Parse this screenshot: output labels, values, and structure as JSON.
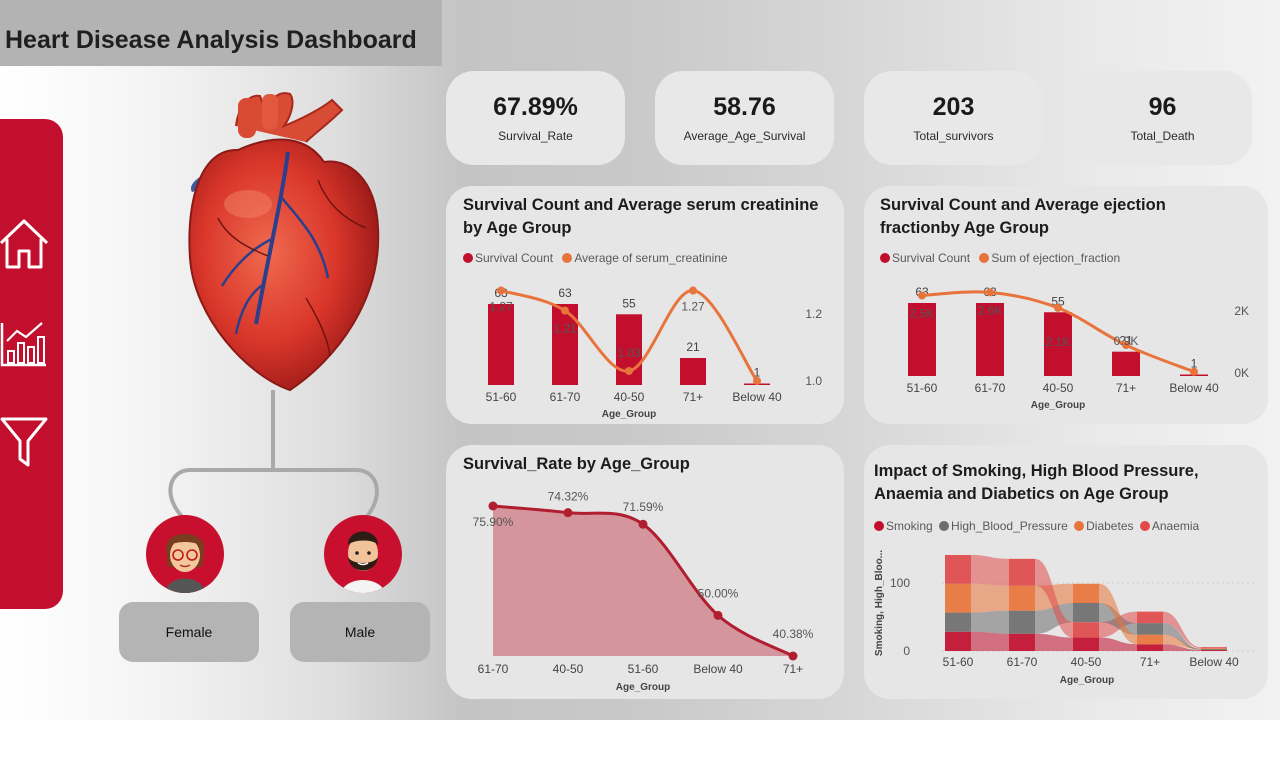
{
  "header": {
    "title": "Heart Disease Analysis Dashboard"
  },
  "nav": {
    "items": [
      "home-icon",
      "analytics-chart-icon",
      "filter-icon"
    ]
  },
  "colors": {
    "accent": "#c10f2d",
    "orange": "#e8743b",
    "grey": "#6e6e6e",
    "coral": "#e04a4a"
  },
  "gender": {
    "female_label": "Female",
    "male_label": "Male"
  },
  "kpis": [
    {
      "value": "67.89%",
      "label": "Survival_Rate"
    },
    {
      "value": "58.76",
      "label": "Average_Age_Survival"
    },
    {
      "value": "203",
      "label": "Total_survivors"
    },
    {
      "value": "96",
      "label": "Total_Death"
    }
  ],
  "chart_data": [
    {
      "type": "bar",
      "title": "Survival Count and Average serum creatinine by Age Group",
      "xlabel": "Age_Group",
      "categories": [
        "51-60",
        "61-70",
        "40-50",
        "71+",
        "Below 40"
      ],
      "series": [
        {
          "name": "Survival Count",
          "type": "bar",
          "values": [
            63,
            63,
            55,
            21,
            1
          ],
          "labels": [
            "63",
            "63",
            "55",
            "21",
            "1"
          ]
        },
        {
          "name": "Average of serum_creatinine",
          "type": "line",
          "values": [
            1.27,
            1.21,
            1.03,
            1.27,
            1.0
          ],
          "labels": [
            "1.27",
            "1.21",
            "1.03",
            "1.27",
            ""
          ]
        }
      ],
      "y2_ticks": [
        "1.2",
        "1.0"
      ],
      "y2lim": [
        1.0,
        1.2
      ]
    },
    {
      "type": "bar",
      "title": "Survival Count and Average ejection fractionby Age Group",
      "xlabel": "Age_Group",
      "categories": [
        "51-60",
        "61-70",
        "40-50",
        "71+",
        "Below 40"
      ],
      "series": [
        {
          "name": "Survival Count",
          "type": "bar",
          "values": [
            63,
            63,
            55,
            21,
            1
          ],
          "labels": [
            "63",
            "63",
            "55",
            "21",
            "1"
          ]
        },
        {
          "name": "Sum of ejection_fraction",
          "type": "line",
          "values": [
            2500,
            2600,
            2100,
            900,
            40
          ],
          "labels": [
            "2.5K",
            "2.6K",
            "2.1K",
            "0.9K",
            ""
          ]
        }
      ],
      "y2_ticks": [
        "2K",
        "0K"
      ],
      "y2lim": [
        0,
        2000
      ]
    },
    {
      "type": "area",
      "title": "Survival_Rate by Age_Group",
      "xlabel": "Age_Group",
      "categories": [
        "61-70",
        "40-50",
        "51-60",
        "Below 40",
        "71+"
      ],
      "series": [
        {
          "name": "Survival_Rate",
          "values": [
            75.9,
            74.32,
            71.59,
            50.0,
            40.38
          ],
          "labels": [
            "75.90%",
            "74.32%",
            "71.59%",
            "50.00%",
            "40.38%"
          ]
        }
      ]
    },
    {
      "type": "area",
      "title": "Impact of Smoking, High Blood Pressure, Anaemia and Diabetics on Age Group",
      "xlabel": "Age_Group",
      "ylabel": "Smoking, High_Bloo...",
      "y_ticks": [
        "100",
        "0"
      ],
      "ylim": [
        0,
        100
      ],
      "categories": [
        "51-60",
        "61-70",
        "40-50",
        "71+",
        "Below 40"
      ],
      "series": [
        {
          "name": "Smoking",
          "values": [
            20,
            18,
            14,
            7,
            1
          ]
        },
        {
          "name": "High_Blood_Pressure",
          "values": [
            20,
            24,
            20,
            12,
            1
          ]
        },
        {
          "name": "Diabetes",
          "values": [
            30,
            26,
            20,
            10,
            1
          ]
        },
        {
          "name": "Anaemia",
          "values": [
            30,
            28,
            16,
            12,
            1
          ]
        }
      ]
    }
  ]
}
